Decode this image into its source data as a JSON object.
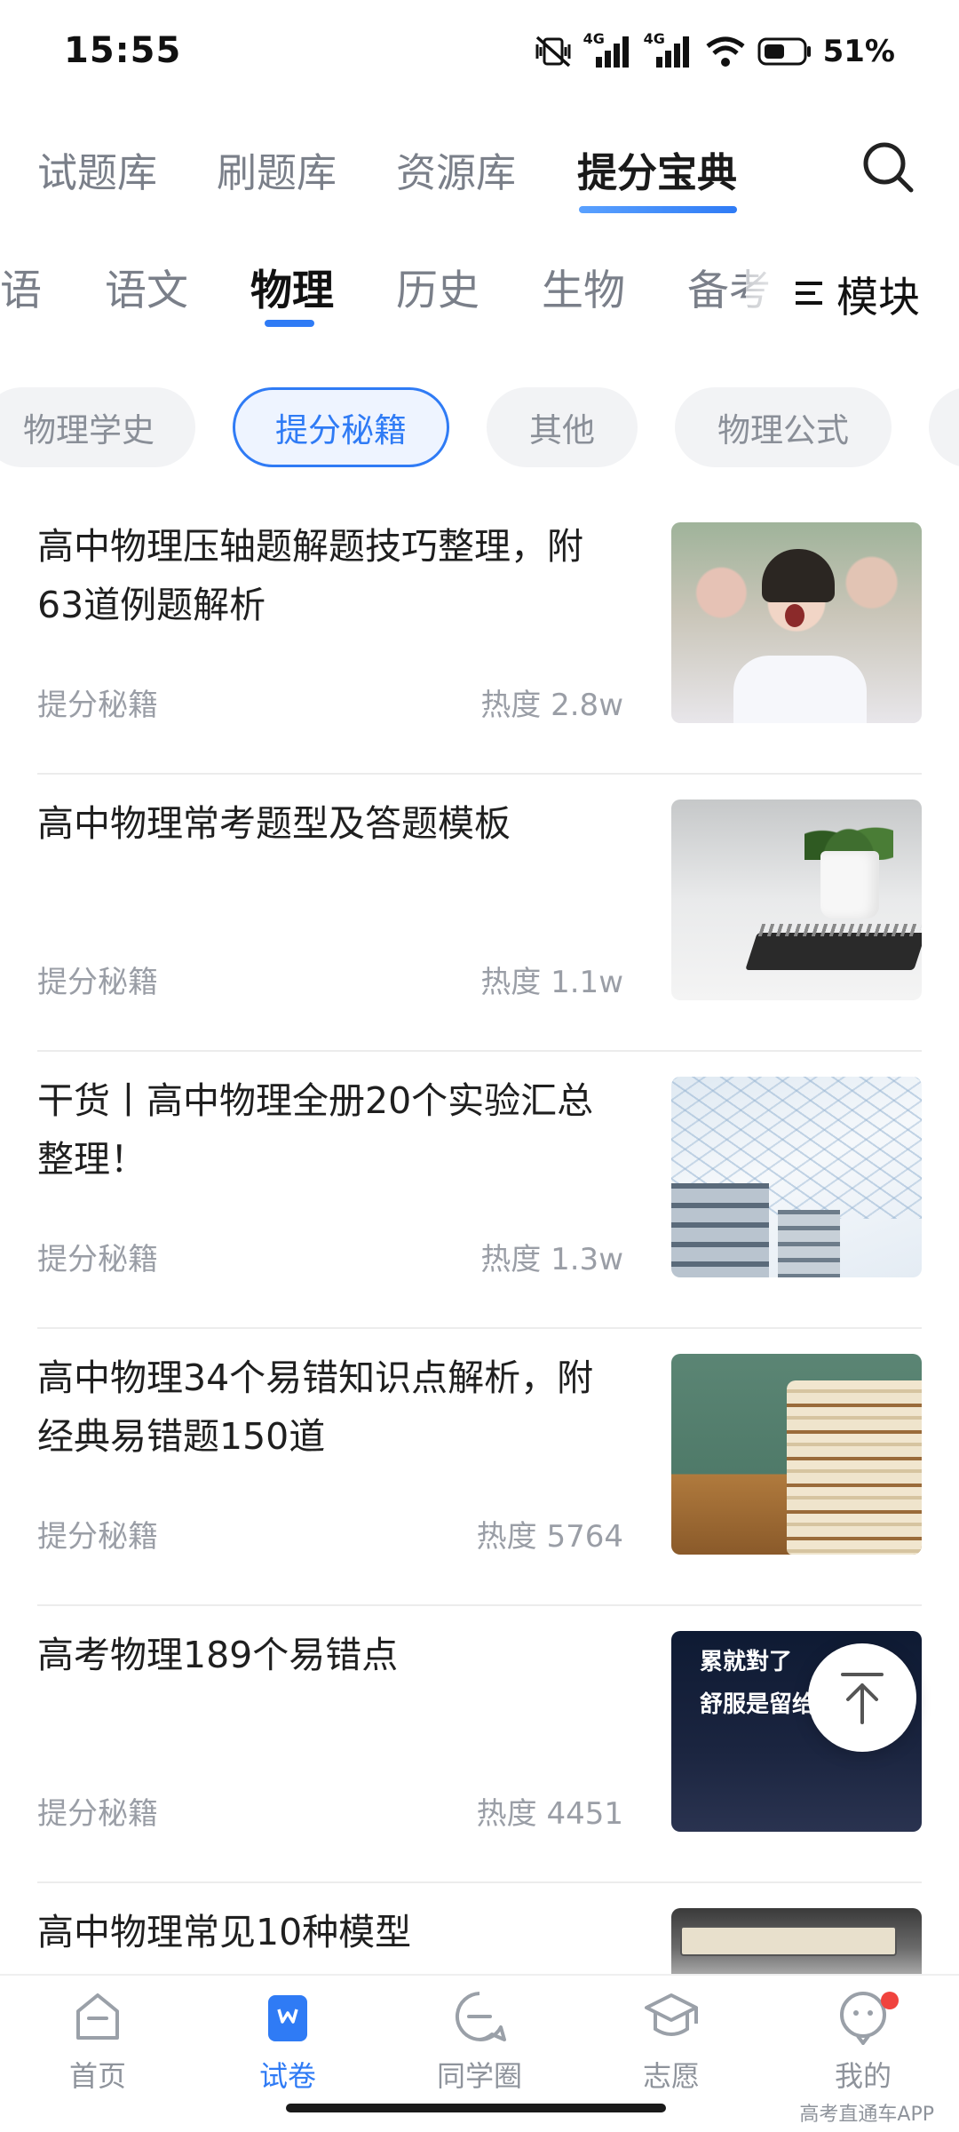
{
  "status_bar": {
    "time": "15:55",
    "network_1": "4G",
    "network_2": "4G",
    "battery_percent": "51%"
  },
  "top_tabs": [
    {
      "label": "试题库",
      "active": false
    },
    {
      "label": "刷题库",
      "active": false
    },
    {
      "label": "资源库",
      "active": false
    },
    {
      "label": "提分宝典",
      "active": true
    }
  ],
  "subject_tabs": [
    {
      "label": "语",
      "active": false
    },
    {
      "label": "语文",
      "active": false
    },
    {
      "label": "物理",
      "active": true
    },
    {
      "label": "历史",
      "active": false
    },
    {
      "label": "生物",
      "active": false
    },
    {
      "label": "备考",
      "active": false
    }
  ],
  "module_button": {
    "label": "模块"
  },
  "chips": [
    {
      "label": "物理学史",
      "active": false
    },
    {
      "label": "提分秘籍",
      "active": true
    },
    {
      "label": "其他",
      "active": false
    },
    {
      "label": "物理公式",
      "active": false
    }
  ],
  "articles": [
    {
      "title": "高中物理压轴题解题技巧整理，附63道例题解析",
      "category": "提分秘籍",
      "heat": "热度 2.8w"
    },
    {
      "title": "高中物理常考题型及答题模板",
      "category": "提分秘籍",
      "heat": "热度 1.1w"
    },
    {
      "title": "干货丨高中物理全册20个实验汇总整理！",
      "category": "提分秘籍",
      "heat": "热度 1.3w"
    },
    {
      "title": "高中物理34个易错知识点解析，附经典易错题150道",
      "category": "提分秘籍",
      "heat": "热度 5764"
    },
    {
      "title": "高考物理189个易错点",
      "category": "提分秘籍",
      "heat": "热度 4451",
      "thumb_text_1": "累就對了",
      "thumb_text_2": "舒服是留给"
    },
    {
      "title": "高中物理常见10种模型",
      "category": "",
      "heat": ""
    }
  ],
  "bottom_nav": [
    {
      "label": "首页",
      "icon": "home-icon",
      "active": false
    },
    {
      "label": "试卷",
      "icon": "paper-icon",
      "active": true
    },
    {
      "label": "同学圈",
      "icon": "chat-icon",
      "active": false
    },
    {
      "label": "志愿",
      "icon": "graduation-cap-icon",
      "active": false
    },
    {
      "label": "我的",
      "icon": "profile-icon",
      "active": false
    }
  ],
  "watermark": "高考直通车APP",
  "colors": {
    "accent": "#2f7bf5",
    "chip_bg": "#f2f3f5",
    "muted_text": "#9a9ea6",
    "badge_red": "#f0433e"
  }
}
